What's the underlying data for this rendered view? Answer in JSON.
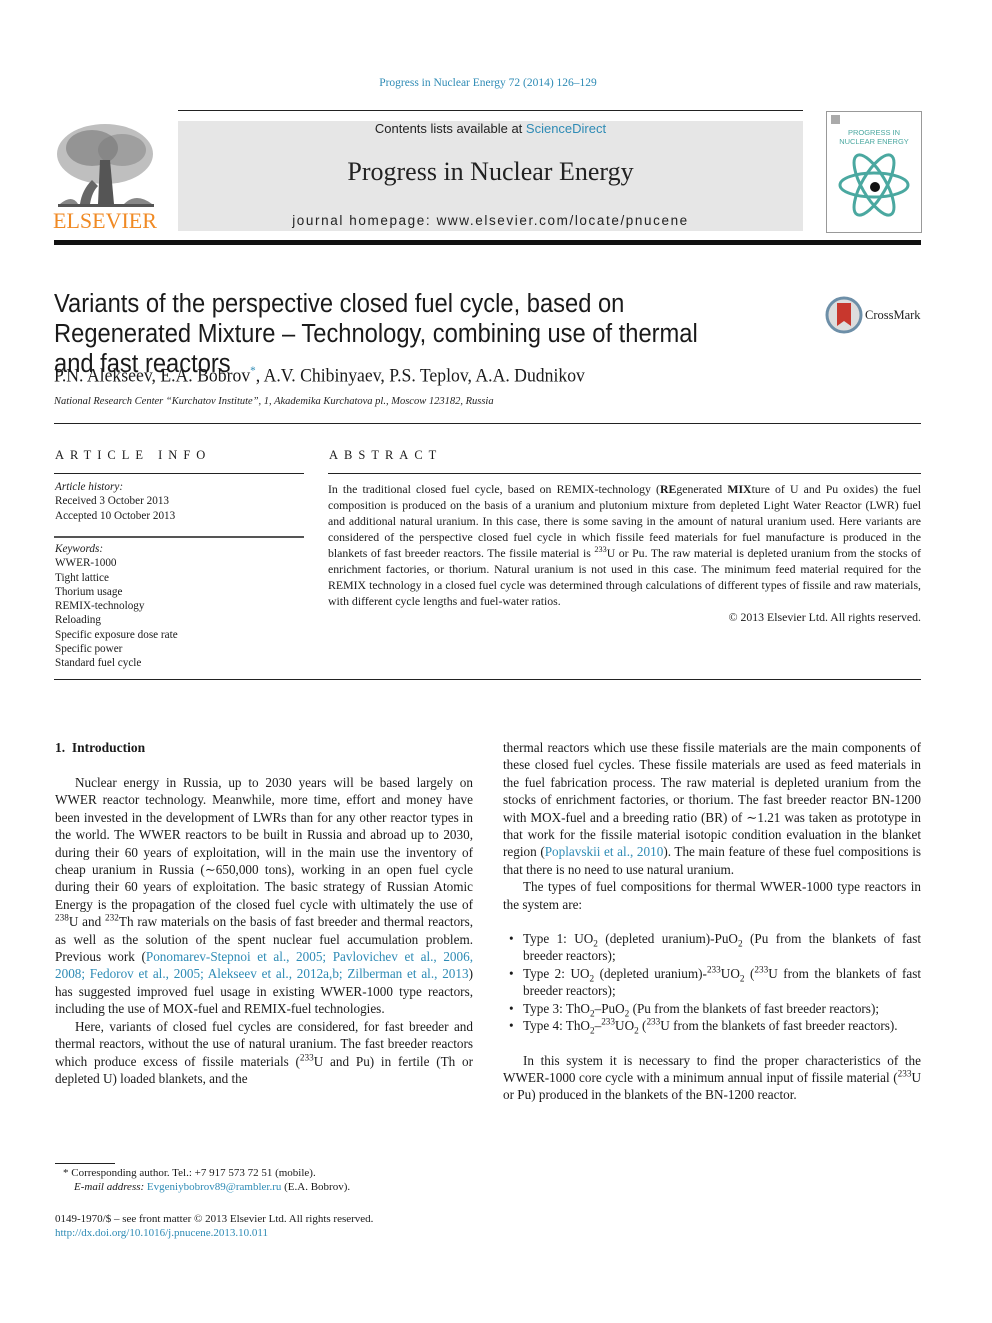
{
  "header": {
    "citation": "Progress in Nuclear Energy 72 (2014) 126–129",
    "publisher_logo_text": "ELSEVIER",
    "contents_prefix": "Contents lists available at ",
    "contents_link": "ScienceDirect",
    "journal_name": "Progress in Nuclear Energy",
    "homepage": "journal homepage: www.elsevier.com/locate/pnucene",
    "cover_title_line1": "PROGRESS IN",
    "cover_title_line2": "NUCLEAR ENERGY"
  },
  "article": {
    "title": "Variants of the perspective closed fuel cycle, based on Regenerated Mixture – Technology, combining use of thermal and fast reactors",
    "crossmark_label": "CrossMark",
    "authors_a": "P.N. Alekseev, E.A. Bobrov",
    "authors_star": "*",
    "authors_b": ", A.V. Chibinyaev, P.S. Teplov, A.A. Dudnikov",
    "affiliation": "National Research Center “Kurchatov Institute”, 1, Akademika Kurchatova pl., Moscow 123182, Russia"
  },
  "article_info": {
    "heading": "ARTICLE INFO",
    "history_label": "Article history:",
    "received": "Received 3 October 2013",
    "accepted": "Accepted 10 October 2013",
    "keywords_label": "Keywords:",
    "keywords": [
      "WWER-1000",
      "Tight lattice",
      "Thorium usage",
      "REMIX-technology",
      "Reloading",
      "Specific exposure dose rate",
      "Specific power",
      "Standard fuel cycle"
    ]
  },
  "abstract": {
    "heading": "ABSTRACT",
    "p1": "In the traditional closed fuel cycle, based on REMIX-technology (",
    "re": "RE",
    "p2": "generated ",
    "mix": "MIX",
    "p3": "ture of U and Pu oxides) the fuel composition is produced on the basis of a uranium and plutonium mixture from depleted Light Water Reactor (LWR) fuel and additional natural uranium. In this case, there is some saving in the amount of natural uranium used. Here variants are considered of the perspective closed fuel cycle in which fissile feed materials for fuel manufacture is produced in the blankets of fast breeder reactors. The fissile material is ",
    "sup233": "233",
    "p4": "U or Pu. The raw material is depleted uranium from the stocks of enrichment factories, or thorium. Natural uranium is not used in this case. The minimum feed material required for the REMIX technology in a closed fuel cycle was determined through calculations of different types of fissile and raw materials, with different cycle lengths and fuel-water ratios.",
    "copyright": "© 2013 Elsevier Ltd. All rights reserved."
  },
  "intro": {
    "heading": "1. Introduction",
    "para1_a": "Nuclear energy in Russia, up to 2030 years will be based largely on WWER reactor technology. Meanwhile, more time, effort and money have been invested in the development of LWRs than for any other reactor types in the world. The WWER reactors to be built in Russia and abroad up to 2030, during their 60 years of exploitation, will in the main use the inventory of cheap uranium in Russia (∼650,000 tons), working in an open fuel cycle during their 60 years of exploitation. The basic strategy of Russian Atomic Energy is the propagation of the closed fuel cycle with ultimately the use of ",
    "sup238": "238",
    "para1_b": "U and ",
    "sup232": "232",
    "para1_c": "Th raw materials on the basis of fast breeder and thermal reactors, as well as the solution of the spent nuclear fuel accumulation problem. Previous work (",
    "refs": "Ponomarev-Stepnoi et al., 2005; Pavlovichev et al., 2006, 2008; Fedorov et al., 2005; Alekseev et al., 2012a,b; Zilberman et al., 2013",
    "para1_d": ") has suggested improved fuel usage in existing WWER-1000 type reactors, including the use of MOX-fuel and REMIX-fuel technologies.",
    "para2_a": "Here, variants of closed fuel cycles are considered, for fast breeder and thermal reactors, without the use of natural uranium. The fast breeder reactors which produce excess of fissile materials (",
    "sup233": "233",
    "para2_b": "U and Pu) in fertile (Th or depleted U) loaded blankets, and the",
    "col2_p1_a": "thermal reactors which use these fissile materials are the main components of these closed fuel cycles. These fissile materials are used as feed materials in the fuel fabrication process. The raw material is depleted uranium from the stocks of enrichment factories, or thorium. The fast breeder reactor BN-1200 with MOX-fuel and a breeding ratio (BR) of ∼1.21 was taken as prototype in that work for the fissile material isotopic condition evaluation in the blanket region (",
    "col2_ref": "Poplavskii et al., 2010",
    "col2_p1_b": "). The main feature of these fuel compositions is that there is no need to use natural uranium.",
    "col2_p2": "The types of fuel compositions for thermal WWER-1000 type reactors in the system are:",
    "types": [
      {
        "a": "Type 1: UO",
        "s1": "2",
        "b": " (depleted uranium)-PuO",
        "s2": "2",
        "c": " (Pu from the blankets of fast breeder reactors);"
      },
      {
        "a": "Type 2: UO",
        "s1": "2",
        "b": " (depleted uranium)-",
        "sup": "233",
        "b2": "UO",
        "s2": "2",
        "c": " (",
        "sup2": "233",
        "c2": "U from the blankets of fast breeder reactors);"
      },
      {
        "a": "Type 3: ThO",
        "s1": "2",
        "b": "–PuO",
        "s2": "2",
        "c": " (Pu from the blankets of fast breeder reactors);"
      },
      {
        "a": "Type 4: ThO",
        "s1": "2",
        "b": "–",
        "sup": "233",
        "b2": "UO",
        "s2": "2",
        "c": " (",
        "sup2": "233",
        "c2": "U from the blankets of fast breeder reactors)."
      }
    ],
    "col2_p3_a": "In this system it is necessary to find the proper characteristics of the WWER-1000 core cycle with a minimum annual input of fissile material (",
    "col2_p3_sup": "233",
    "col2_p3_b": "U or Pu) produced in the blankets of the BN-1200 reactor."
  },
  "footnotes": {
    "corresponding": "* Corresponding author. Tel.: +7 917 573 72 51 (mobile).",
    "email_label": "E-mail address: ",
    "email": "Evgeniybobrov89@rambler.ru",
    "email_suffix": " (E.A. Bobrov).",
    "front_matter": "0149-1970/$ – see front matter © 2013 Elsevier Ltd. All rights reserved.",
    "doi": "http://dx.doi.org/10.1016/j.pnucene.2013.10.011"
  },
  "colors": {
    "link": "#2e8bb5",
    "elsevier_orange": "#f08a24",
    "banner_gray": "#e6e6e6",
    "atom_teal": "#4aa8a0",
    "crossmark_red": "#c8372d"
  }
}
